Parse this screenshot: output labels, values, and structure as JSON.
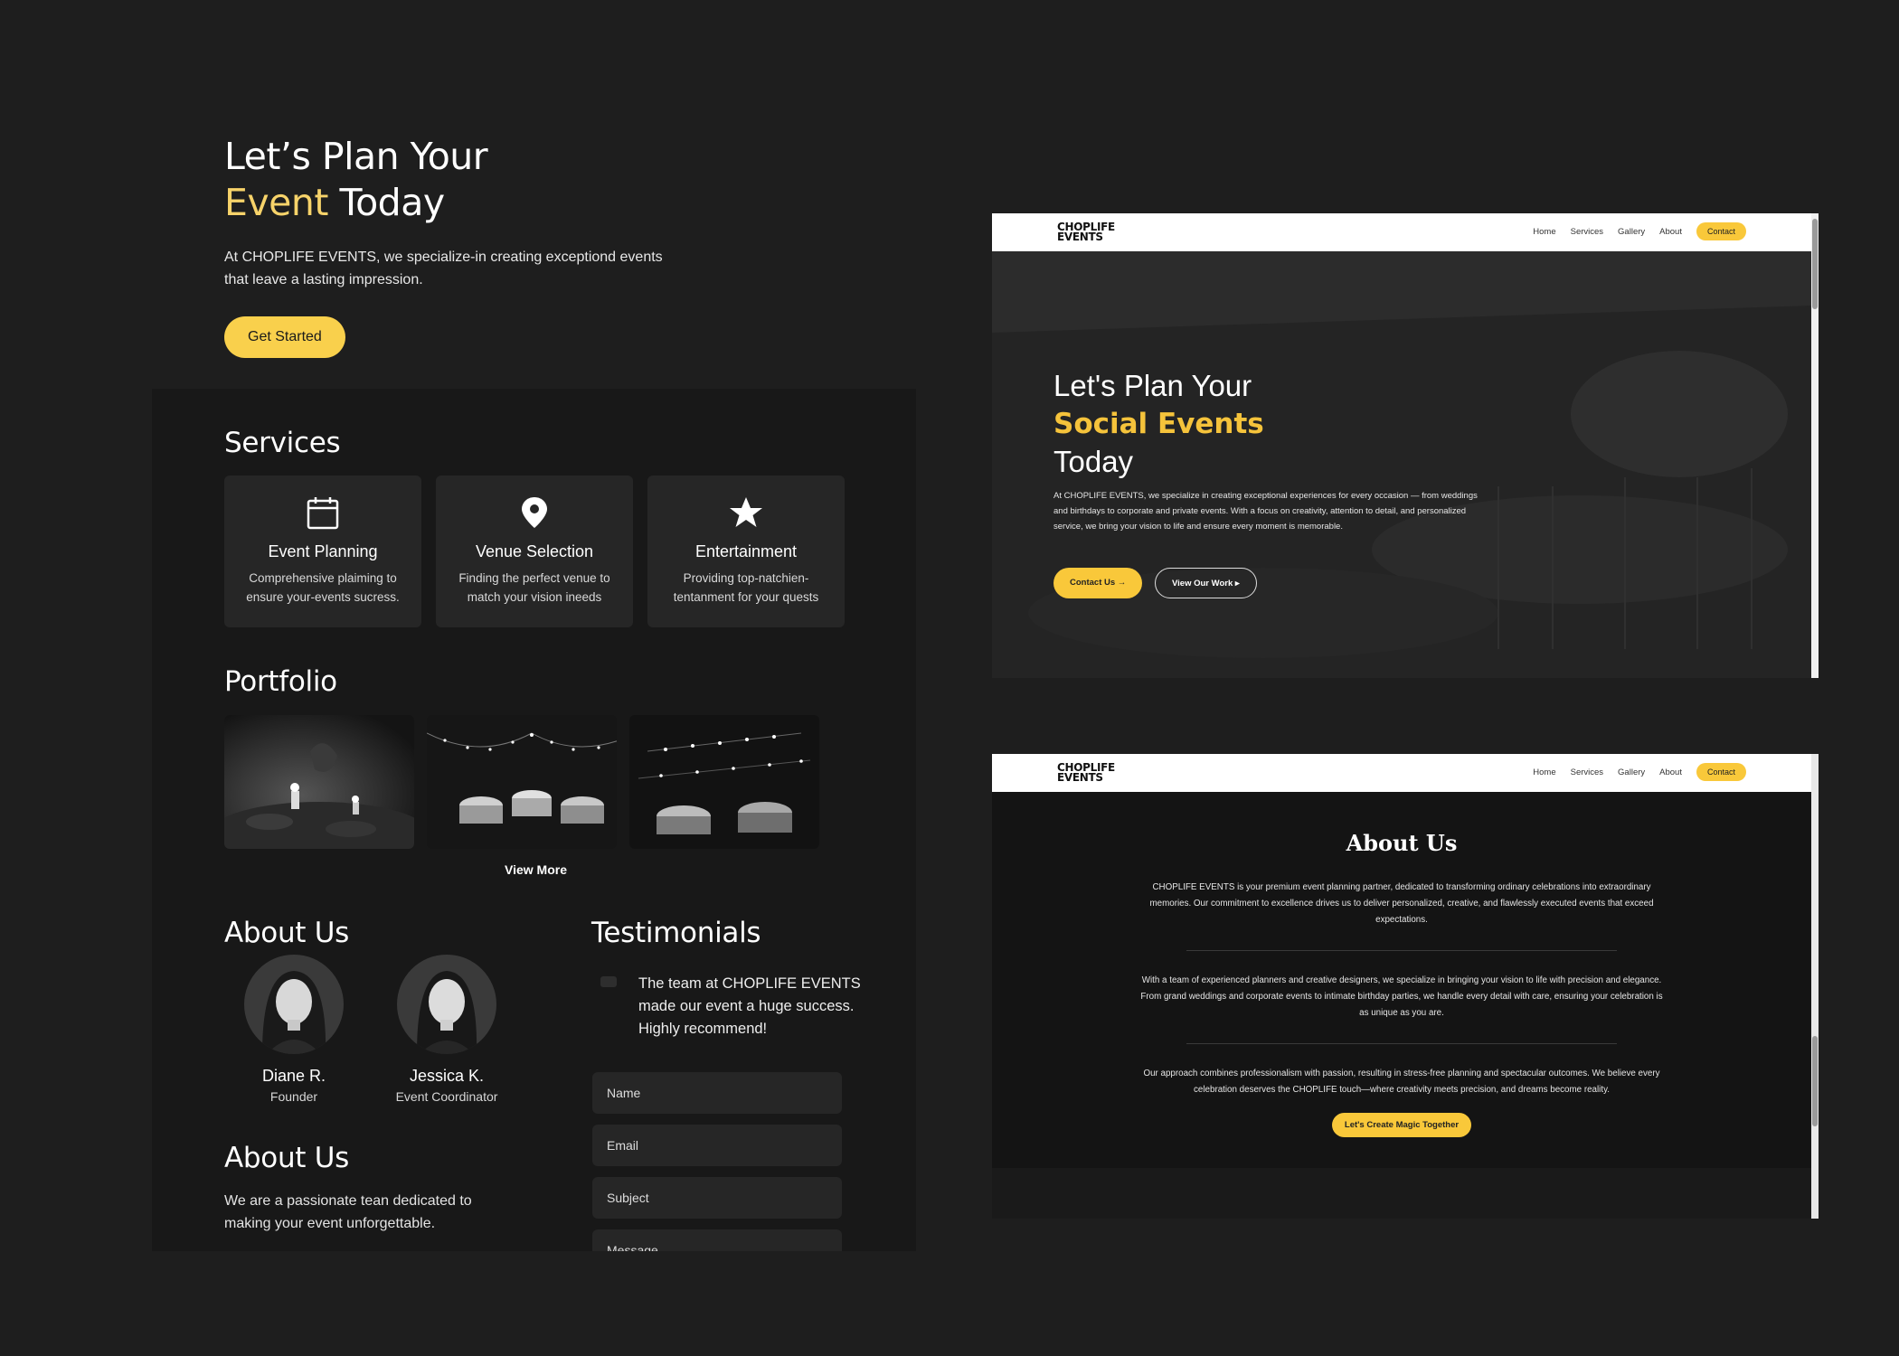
{
  "hero": {
    "title_line1": "Let’s Plan Your",
    "title_accent": "Event",
    "title_rest": " Today",
    "description": "At CHOPLIFE EVENTS, we specialize-in creating exceptiond events that leave a lasting impression.",
    "cta_label": "Get Started"
  },
  "services": {
    "title": "Services",
    "items": [
      {
        "icon": "calendar-icon",
        "title": "Event Planning",
        "description": "Comprehensive plaiming to ensure your-events sucress."
      },
      {
        "icon": "location-pin-icon",
        "title": "Venue Selection",
        "description": "Finding the perfect venue to match your vision ineeds"
      },
      {
        "icon": "star-icon",
        "title": "Entertainment",
        "description": "Providing top-natchien-tentanment for your quests"
      }
    ]
  },
  "portfolio": {
    "title": "Portfolio",
    "view_more": "View More"
  },
  "about": {
    "title": "About Us",
    "team": [
      {
        "name": "Diane R.",
        "role": "Founder"
      },
      {
        "name": "Jessica K.",
        "role": "Event Coordinator"
      }
    ],
    "title2": "About Us",
    "text": "We are a passionate tean dedicated to making your event unforgettable."
  },
  "testimonials": {
    "title": "Testimonials",
    "quote": "The team at CHOPLIFE EVENTS made our event a huge success. Highly recommend!"
  },
  "contact_form": {
    "name_placeholder": "Name",
    "email_placeholder": "Email",
    "subject_placeholder": "Subject",
    "message_placeholder": "Message"
  },
  "site": {
    "logo_line1": "CHOPLIFE",
    "logo_line2": "EVENTS",
    "nav": [
      "Home",
      "Services",
      "Gallery",
      "About"
    ],
    "nav_contact": "Contact"
  },
  "preview_hero": {
    "line1": "Let's Plan Your",
    "highlight": "Social Events",
    "line3": "Today",
    "description": "At CHOPLIFE EVENTS, we specialize in creating exceptional experiences for every occasion — from weddings and birthdays to corporate and private events. With a focus on creativity, attention to detail, and personalized service, we bring your vision to life and ensure every moment is memorable.",
    "contact_btn": "Contact Us  →",
    "work_btn": "View Our Work  ▸"
  },
  "preview_about": {
    "title": "About Us",
    "p1": "CHOPLIFE EVENTS is your premium event planning partner, dedicated to transforming ordinary celebrations into extraordinary memories. Our commitment to excellence drives us to deliver personalized, creative, and flawlessly executed events that exceed expectations.",
    "p2": "With a team of experienced planners and creative designers, we specialize in bringing your vision to life with precision and elegance. From grand weddings and corporate events to intimate birthday parties, we handle every detail with care, ensuring your celebration is as unique as you are.",
    "p3": "Our approach combines professionalism with passion, resulting in stress-free planning and spectacular outcomes. We believe every celebration deserves the CHOPLIFE touch—where creativity meets precision, and dreams become reality.",
    "cta": "Let's Create Magic Together"
  },
  "colors": {
    "accent": "#f9d04c",
    "background": "#1e1e1e",
    "panel": "#181818"
  }
}
